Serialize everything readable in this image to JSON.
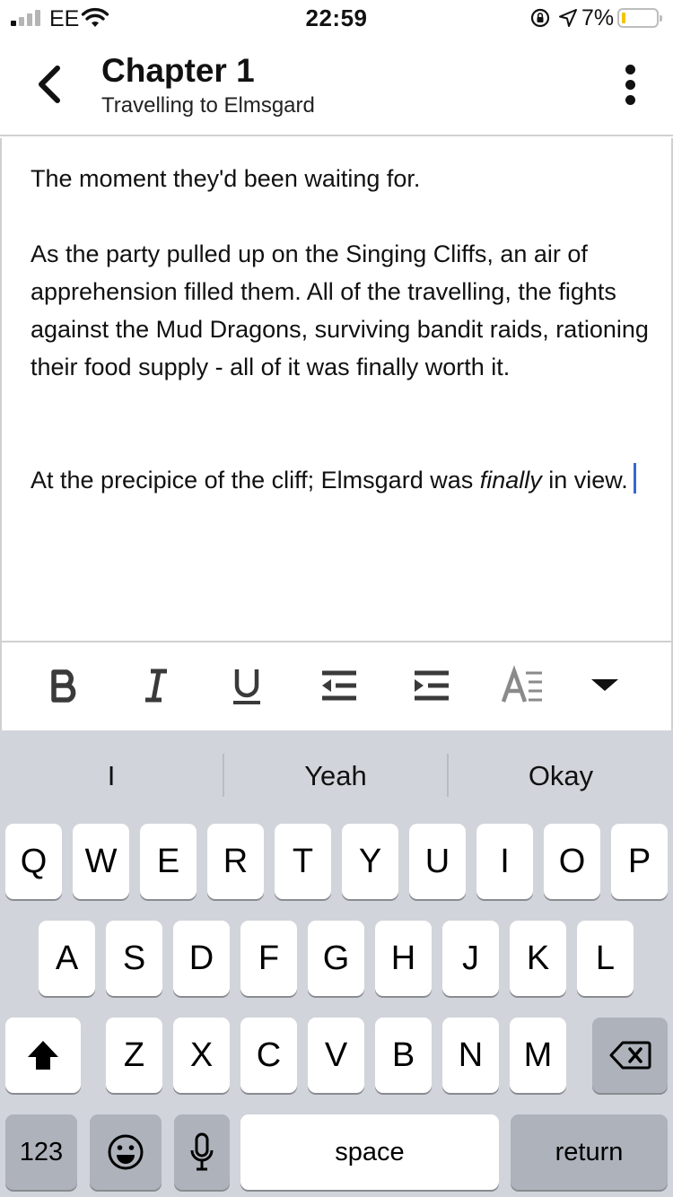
{
  "status_bar": {
    "carrier": "EE",
    "time": "22:59",
    "battery_percent": "7%",
    "battery_level": 0.07,
    "colors": {
      "battery_fill": "#f5c400"
    }
  },
  "header": {
    "title": "Chapter 1",
    "subtitle": "Travelling to Elmsgard",
    "back_icon": "chevron-left-icon",
    "menu_icon": "more-vertical-icon"
  },
  "editor": {
    "paragraph_1": "The moment they'd been waiting for.",
    "paragraph_2": "As the party pulled up on the Singing Cliffs, an air of apprehension filled them. All of the travelling, the fights against the Mud Dragons, surviving bandit raids, rationing their food supply - all of it was finally worth it.",
    "paragraph_3_before": "At the precipice of the cliff; Elmsgard was ",
    "paragraph_3_italic": "finally",
    "paragraph_3_after": " in view.",
    "cursor_color": "#3a66d6"
  },
  "toolbar": {
    "buttons": [
      "bold-icon",
      "italic-icon",
      "underline-icon",
      "outdent-icon",
      "indent-icon",
      "text-style-icon",
      "caret-down-icon"
    ]
  },
  "keyboard": {
    "suggestions": [
      "I",
      "Yeah",
      "Okay"
    ],
    "row1": [
      "Q",
      "W",
      "E",
      "R",
      "T",
      "Y",
      "U",
      "I",
      "O",
      "P"
    ],
    "row2": [
      "A",
      "S",
      "D",
      "F",
      "G",
      "H",
      "J",
      "K",
      "L"
    ],
    "row3": [
      "Z",
      "X",
      "C",
      "V",
      "B",
      "N",
      "M"
    ],
    "numbers_label": "123",
    "space_label": "space",
    "return_label": "return"
  }
}
